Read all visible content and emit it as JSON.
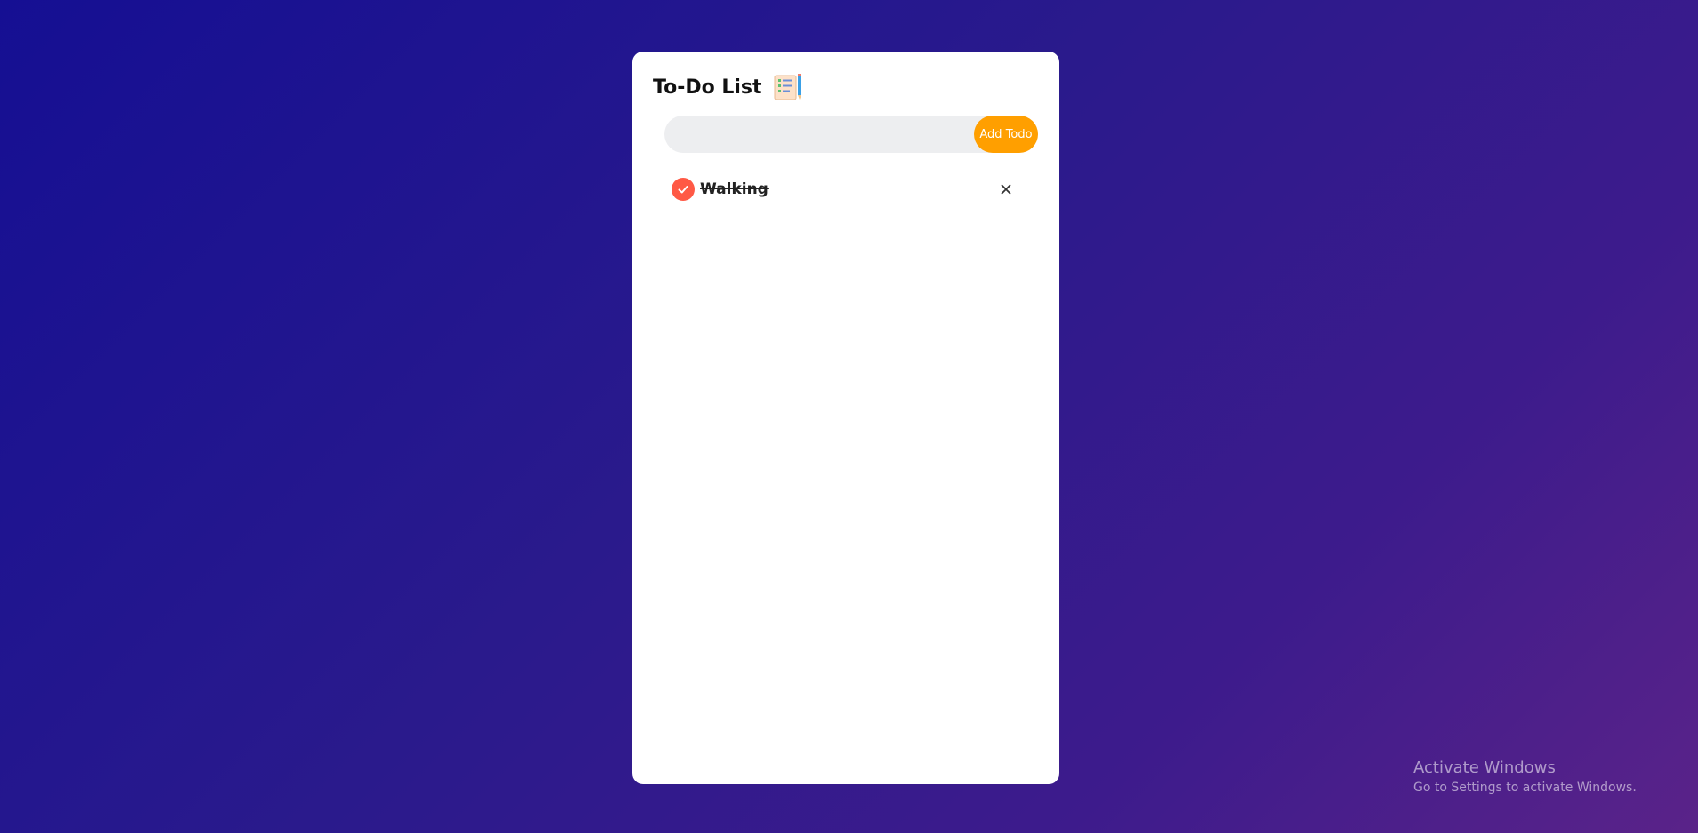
{
  "app": {
    "title": "To-Do List",
    "title_icon": "checklist-notepad-icon"
  },
  "input": {
    "value": "",
    "placeholder": "",
    "add_button_label": "Add Todo"
  },
  "todos": [
    {
      "text": "Walking",
      "completed": true
    }
  ],
  "icons": {
    "check": "check-icon",
    "delete": "close-icon"
  },
  "colors": {
    "accent_button": "#ff9f00",
    "check_circle": "#ff5945",
    "background_start": "#150f93",
    "background_end": "#5a2389"
  },
  "watermark": {
    "title": "Activate Windows",
    "subtitle": "Go to Settings to activate Windows."
  }
}
